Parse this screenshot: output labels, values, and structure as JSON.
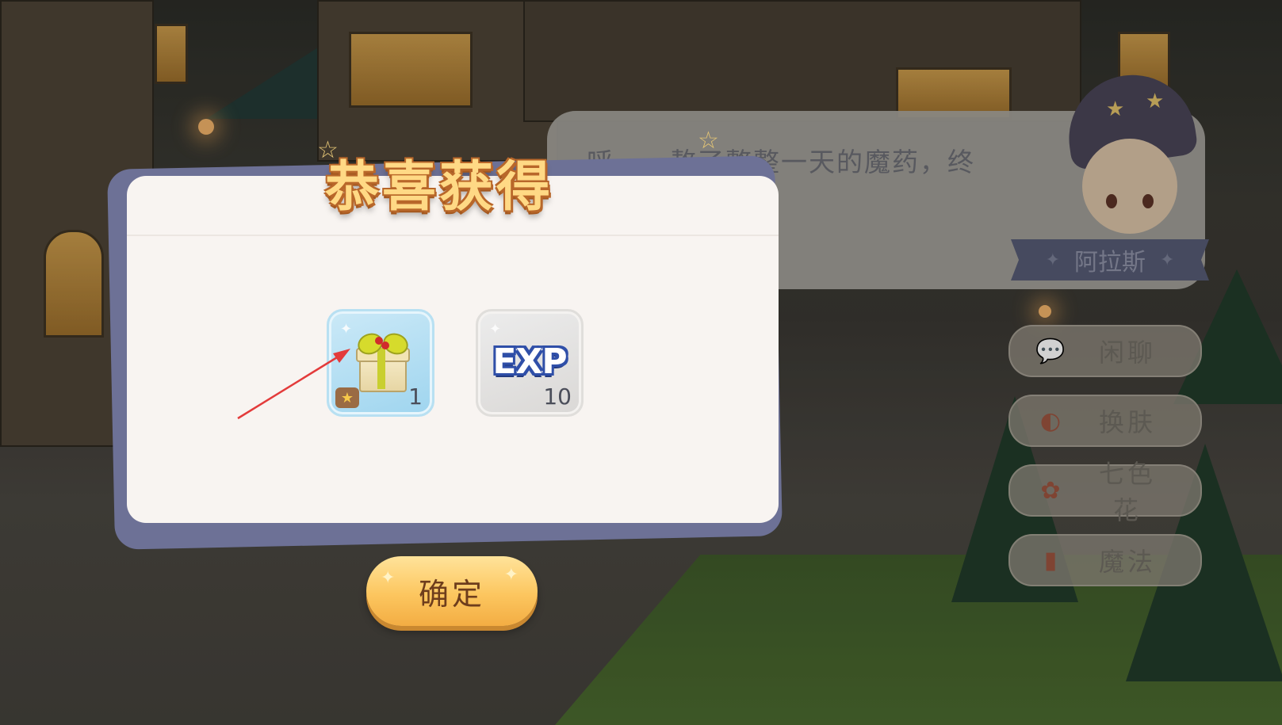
{
  "popup": {
    "title": "恭喜获得",
    "rewards": [
      {
        "item": "gift-box",
        "count": "1"
      },
      {
        "item": "exp",
        "label": "EXP",
        "count": "10"
      }
    ],
    "confirm_label": "确定"
  },
  "dialogue": {
    "text": "呼——熬了整整一天的魔药，终",
    "speaker_name": "阿拉斯"
  },
  "side_menu": {
    "items": [
      {
        "label": "闲聊",
        "icon": "chat-bubble-icon"
      },
      {
        "label": "换肤",
        "icon": "palette-icon"
      },
      {
        "label": "七色花",
        "icon": "flower-icon"
      },
      {
        "label": "魔法",
        "icon": "spellbook-icon"
      }
    ]
  },
  "colors": {
    "popup_bg": "#f8f4f1",
    "popup_frame": "#6d7196",
    "title_fill": "#ffd985",
    "title_outline": "#b8672a",
    "button_gradient_top": "#ffe39a",
    "button_gradient_bottom": "#f3ad43",
    "arrow": "#e33b3b"
  }
}
